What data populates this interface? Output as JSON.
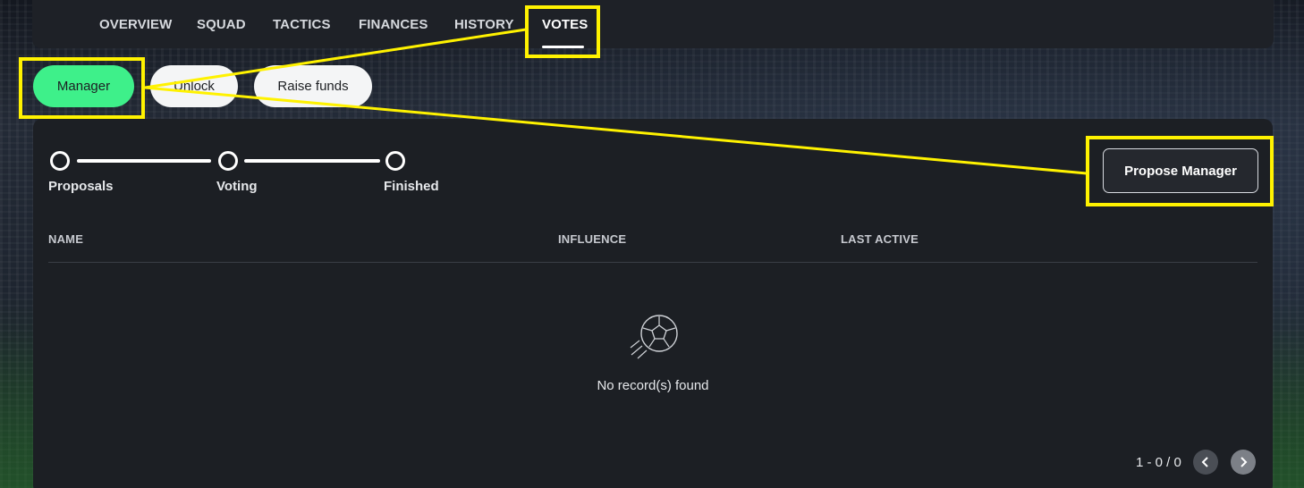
{
  "nav": {
    "tabs": [
      {
        "label": "OVERVIEW"
      },
      {
        "label": "SQUAD"
      },
      {
        "label": "TACTICS"
      },
      {
        "label": "FINANCES"
      },
      {
        "label": "HISTORY"
      },
      {
        "label": "VOTES",
        "active": true
      }
    ]
  },
  "vote_types": {
    "manager": "Manager",
    "unlock": "Unlock",
    "raise_funds": "Raise funds",
    "selected": "Manager"
  },
  "progress": {
    "steps": [
      "Proposals",
      "Voting",
      "Finished"
    ]
  },
  "actions": {
    "propose_label": "Propose Manager"
  },
  "table": {
    "columns": [
      "NAME",
      "INFLUENCE",
      "LAST ACTIVE"
    ],
    "rows": [],
    "empty_message": "No record(s) found",
    "empty_icon": "soccer-ball-icon"
  },
  "pagination": {
    "summary": "1 - 0 / 0"
  },
  "colors": {
    "accent": "#3ef08a",
    "annotation": "#fff200",
    "panel": "#1c1f24"
  }
}
